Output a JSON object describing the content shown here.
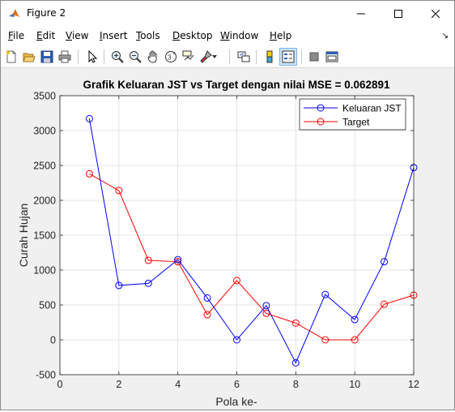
{
  "window": {
    "title": "Figure 2",
    "icon": "matlab-icon",
    "controls": [
      "minimize-icon",
      "maximize-icon",
      "close-icon"
    ]
  },
  "menu": {
    "items": [
      {
        "label": "File",
        "u": "F",
        "rest": "ile"
      },
      {
        "label": "Edit",
        "u": "E",
        "rest": "dit"
      },
      {
        "label": "View",
        "u": "V",
        "rest": "iew"
      },
      {
        "label": "Insert",
        "u": "I",
        "rest": "nsert"
      },
      {
        "label": "Tools",
        "u": "T",
        "rest": "ools"
      },
      {
        "label": "Desktop",
        "u": "D",
        "rest": "esktop"
      },
      {
        "label": "Window",
        "u": "W",
        "rest": "indow"
      },
      {
        "label": "Help",
        "u": "H",
        "rest": "elp"
      }
    ],
    "overflow_icon": "menu-overflow-arrow-icon"
  },
  "toolbar": {
    "buttons": [
      "new-figure-icon",
      "open-file-icon",
      "save-icon",
      "print-icon",
      "edit-plot-arrow-icon",
      "zoom-in-icon",
      "zoom-out-icon",
      "pan-hand-icon",
      "rotate-3d-icon",
      "data-cursor-icon",
      "brush-icon",
      "link-plot-icon",
      "insert-colorbar-icon",
      "insert-legend-icon",
      "hide-plot-tools-icon",
      "show-plot-tools-icon"
    ]
  },
  "chart_data": {
    "type": "line",
    "title": "Grafik Keluaran JST vs Target dengan nilai MSE = 0.062891",
    "xlabel": "Pola ke-",
    "ylabel": "Curah Hujan",
    "xlim": [
      0,
      12
    ],
    "ylim": [
      -500,
      3500
    ],
    "xticks": [
      0,
      2,
      4,
      6,
      8,
      10,
      12
    ],
    "yticks": [
      -500,
      0,
      500,
      1000,
      1500,
      2000,
      2500,
      3000,
      3500
    ],
    "grid": true,
    "legend_position": "top-right",
    "x": [
      1,
      2,
      3,
      4,
      5,
      6,
      7,
      8,
      9,
      10,
      11,
      12
    ],
    "series": [
      {
        "name": "Keluaran JST",
        "color": "#0000ff",
        "marker": "circle",
        "values": [
          3170,
          780,
          810,
          1150,
          600,
          0,
          490,
          -330,
          650,
          290,
          1120,
          2470
        ]
      },
      {
        "name": "Target",
        "color": "#ff0000",
        "marker": "circle",
        "values": [
          2380,
          2140,
          1140,
          1120,
          360,
          850,
          380,
          240,
          0,
          0,
          510,
          640
        ]
      }
    ]
  }
}
